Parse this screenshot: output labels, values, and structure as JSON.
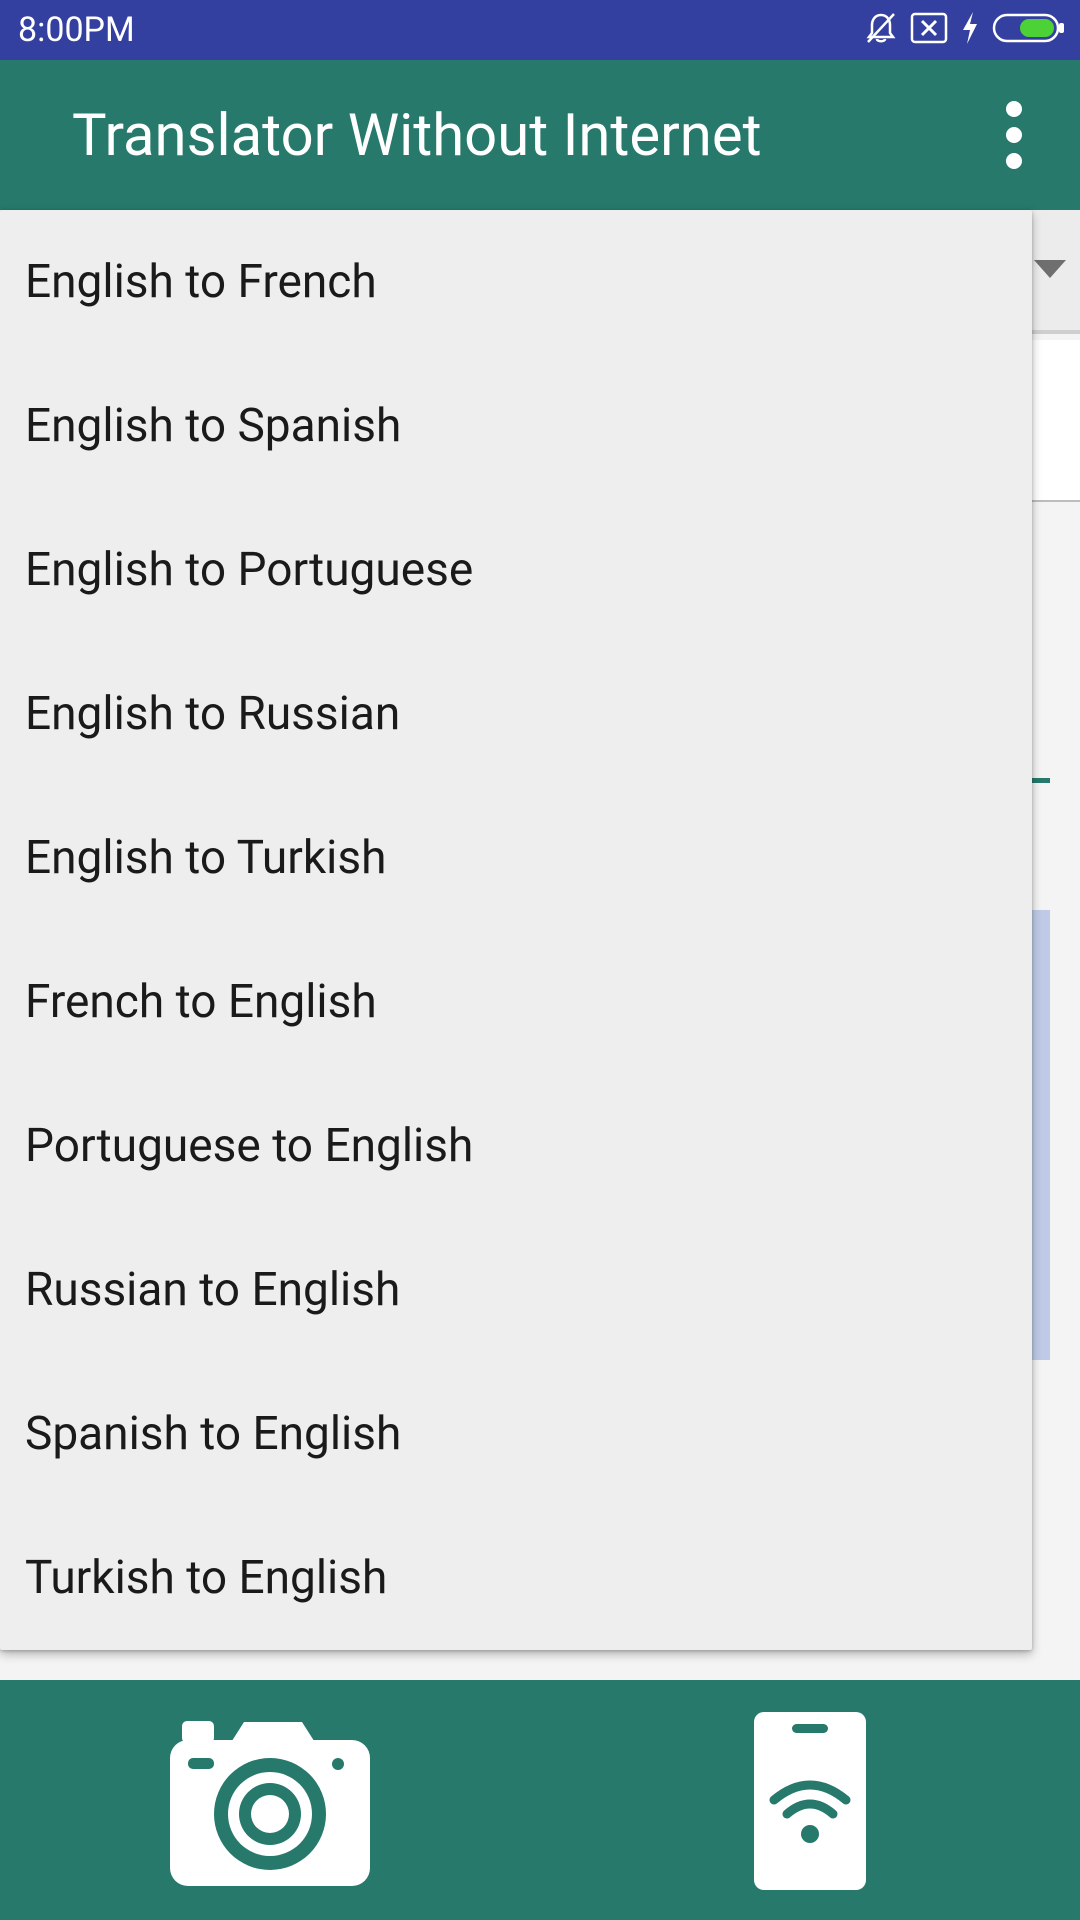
{
  "status_bar": {
    "time": "8:00PM",
    "icons": [
      "notifications-off-icon",
      "sim-error-icon",
      "charging-bolt-icon",
      "battery-icon"
    ]
  },
  "app_bar": {
    "title": "Translator Without Internet",
    "menu_icon": "more-vert-icon"
  },
  "dropdown": {
    "items": [
      "English to French",
      "English to Spanish",
      "English to Portuguese",
      "English to Russian",
      "English to Turkish",
      "French to English",
      "Portuguese to English",
      "Russian to English",
      "Spanish to English",
      "Turkish to English"
    ]
  },
  "bottom_bar": {
    "left_icon": "camera-icon",
    "right_icon": "phone-wifi-icon"
  },
  "colors": {
    "status_bar": "#3440a0",
    "primary": "#26796b",
    "menu_bg": "#eeeeee",
    "battery_fill": "#4cd137"
  }
}
